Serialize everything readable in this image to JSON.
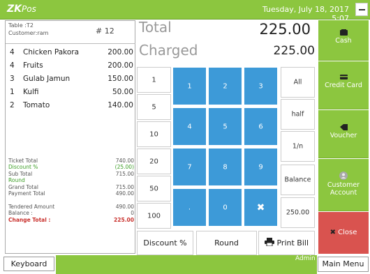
{
  "app": {
    "logo_main": "ZK",
    "logo_sub": "Pos",
    "datetime": "Tuesday, July 18, 2017 5:07"
  },
  "ticket": {
    "table": "Table :T2",
    "customer": "Customer:ram",
    "number": "# 12"
  },
  "order_items": [
    {
      "qty": "4",
      "name": "Chicken Pakora",
      "price": "200.00"
    },
    {
      "qty": "4",
      "name": "Fruits",
      "price": "200.00"
    },
    {
      "qty": "3",
      "name": "Gulab Jamun",
      "price": "150.00"
    },
    {
      "qty": "1",
      "name": "Kulfi",
      "price": "50.00"
    },
    {
      "qty": "2",
      "name": "Tomato",
      "price": "140.00"
    }
  ],
  "summary": {
    "ticket_total_label": "Ticket Total",
    "ticket_total": "740.00",
    "discount_label": "Discount %",
    "discount": "(25.00)",
    "sub_total_label": "Sub Total",
    "sub_total": "715.00",
    "round_label": "Round",
    "grand_total_label": "Grand Total",
    "grand_total": "715.00",
    "payment_total_label": "Payment Total",
    "payment_total": "490.00",
    "tendered_label": "Tendered Amount",
    "tendered": "490.00",
    "balance_label": "Balance :",
    "balance": "0",
    "change_label": "Change Total :",
    "change": "225.00"
  },
  "display": {
    "total_label": "Total",
    "total_value": "225.00",
    "charged_label": "Charged",
    "charged_value": "225.00"
  },
  "quick_amounts": [
    "1",
    "5",
    "10",
    "20",
    "50",
    "100"
  ],
  "keypad": [
    "1",
    "2",
    "3",
    "4",
    "5",
    "6",
    "7",
    "8",
    "9",
    ".",
    "0",
    "✖"
  ],
  "right_keys": [
    "All",
    "half",
    "1/n",
    "Balance",
    "250.00"
  ],
  "bottom_buttons": {
    "discount": "Discount %",
    "round": "Round",
    "print": "Print Bill"
  },
  "payments": {
    "cash": "Cash",
    "credit": "Credit Card",
    "voucher": "Voucher",
    "customer": "Customer Account",
    "close": "Close"
  },
  "footer": {
    "keyboard": "Keyboard",
    "user": "Admin",
    "main_menu": "Main Menu"
  },
  "colors": {
    "green": "#8cc63f",
    "blue": "#3d9ad8",
    "red": "#d9534f",
    "discount_green": "#3a9d23",
    "change_red": "#c9302c"
  }
}
